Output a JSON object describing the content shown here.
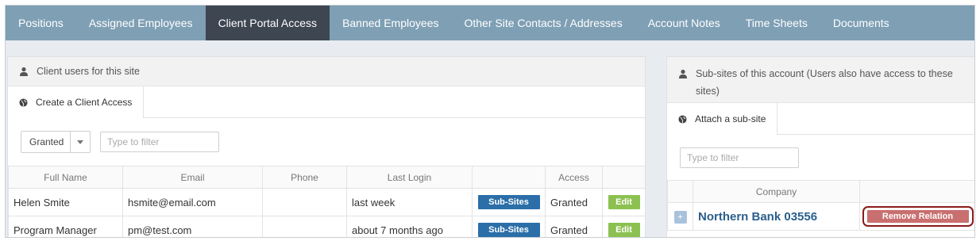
{
  "tabs": [
    {
      "label": "Positions",
      "active": false
    },
    {
      "label": "Assigned Employees",
      "active": false
    },
    {
      "label": "Client Portal Access",
      "active": true
    },
    {
      "label": "Banned Employees",
      "active": false
    },
    {
      "label": "Other Site Contacts / Addresses",
      "active": false
    },
    {
      "label": "Account Notes",
      "active": false
    },
    {
      "label": "Time Sheets",
      "active": false
    },
    {
      "label": "Documents",
      "active": false
    }
  ],
  "left_panel": {
    "title": "Client users for this site",
    "title_icon": "user-icon",
    "create_label": "Create a Client Access",
    "create_icon": "globe-icon",
    "status_select": "Granted",
    "filter_placeholder": "Type to filter",
    "columns": [
      "Full Name",
      "Email",
      "Phone",
      "Last Login",
      "",
      "Access",
      ""
    ],
    "rows": [
      {
        "name": "Helen Smite",
        "email": "hsmite@email.com",
        "phone": "",
        "last_login": "last week",
        "subsites_label": "Sub-Sites",
        "access": "Granted",
        "edit_label": "Edit"
      },
      {
        "name": "Program Manager",
        "email": "pm@test.com",
        "phone": "",
        "last_login": "about 7 months ago",
        "subsites_label": "Sub-Sites",
        "access": "Granted",
        "edit_label": "Edit"
      }
    ]
  },
  "right_panel": {
    "title": "Sub-sites of this account (Users also have access to these sites)",
    "title_icon": "user-icon",
    "attach_label": "Attach a sub-site",
    "attach_icon": "globe-icon",
    "filter_placeholder": "Type to filter",
    "columns": [
      "",
      "Company",
      ""
    ],
    "rows": [
      {
        "expand_label": "+",
        "company": "Northern Bank 03556",
        "remove_label": "Remove Relation"
      }
    ]
  },
  "colors": {
    "tab_bar": "#7e9fb4",
    "tab_active": "#3d4651",
    "subsites_button": "#2b6ea8",
    "edit_button": "#8cc152",
    "remove_button": "#c96f6f",
    "remove_highlight": "#8b1a1a",
    "company_link": "#2b5e8c"
  }
}
